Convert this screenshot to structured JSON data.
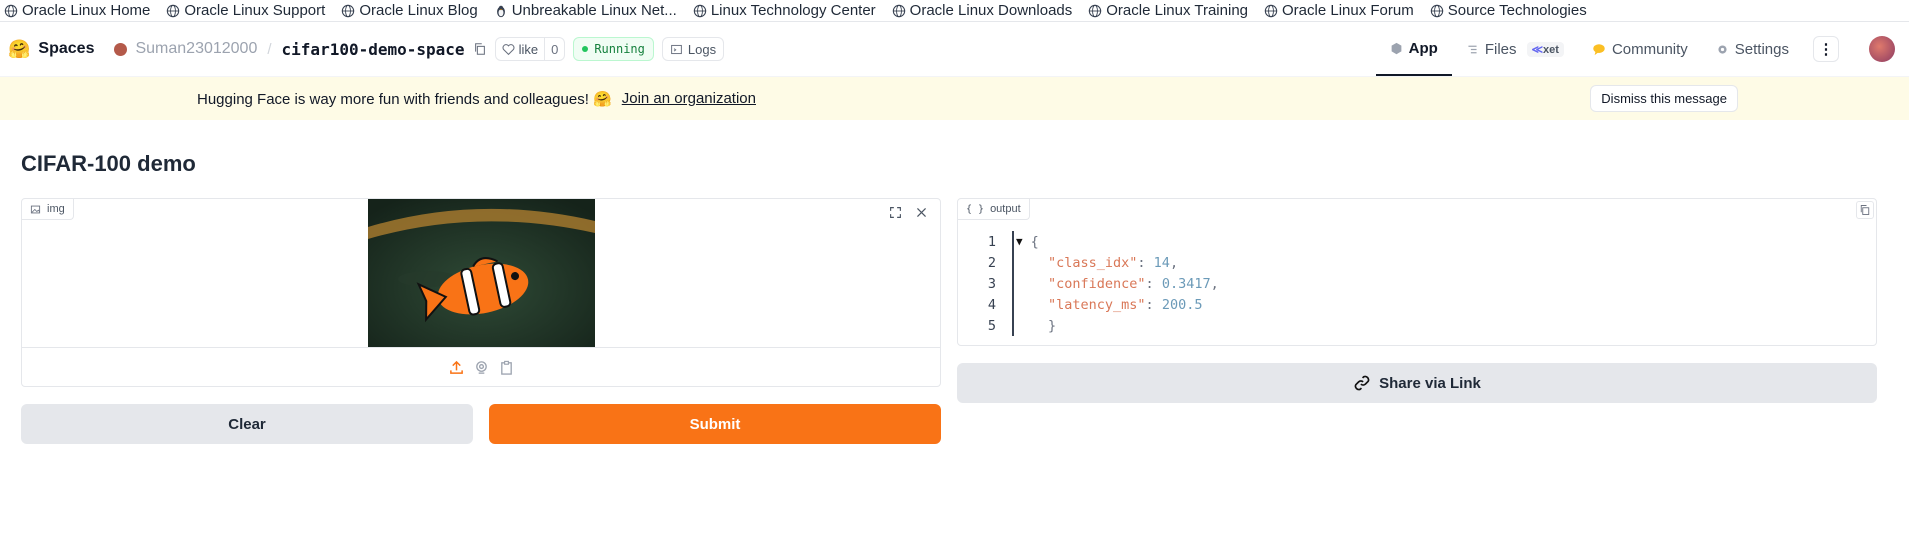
{
  "bookmarks": [
    {
      "label": "Oracle Linux Home",
      "icon": "globe-icon"
    },
    {
      "label": "Oracle Linux Support",
      "icon": "globe-icon"
    },
    {
      "label": "Oracle Linux Blog",
      "icon": "globe-icon"
    },
    {
      "label": "Unbreakable Linux Net...",
      "icon": "penguin-icon"
    },
    {
      "label": "Linux Technology Center",
      "icon": "globe-icon"
    },
    {
      "label": "Oracle Linux Downloads",
      "icon": "globe-icon"
    },
    {
      "label": "Oracle Linux Training",
      "icon": "globe-icon"
    },
    {
      "label": "Oracle Linux Forum",
      "icon": "globe-icon"
    },
    {
      "label": "Source Technologies",
      "icon": "globe-icon"
    }
  ],
  "header": {
    "spaces_label": "Spaces",
    "user": "Suman23012000",
    "repo": "cifar100-demo-space",
    "like_label": "like",
    "like_count": "0",
    "status": "Running",
    "logs_label": "Logs",
    "tabs": [
      {
        "label": "App"
      },
      {
        "label": "Files"
      },
      {
        "label": "Community"
      },
      {
        "label": "Settings"
      }
    ],
    "xet_label": "xet"
  },
  "banner": {
    "text": "Hugging Face is way more fun with friends and colleagues! 🤗",
    "link": "Join an organization",
    "dismiss": "Dismiss this message"
  },
  "app": {
    "title": "CIFAR-100 demo",
    "input_label": "img",
    "output_label": "output",
    "clear_label": "Clear",
    "submit_label": "Submit",
    "share_label": "Share via Link",
    "code_lines": [
      {
        "n": "1",
        "text": "{"
      },
      {
        "n": "2",
        "key": "\"class_idx\"",
        "val": "14"
      },
      {
        "n": "3",
        "key": "\"confidence\"",
        "val": "0.3417"
      },
      {
        "n": "4",
        "key": "\"latency_ms\"",
        "val": "200.5"
      },
      {
        "n": "5",
        "text": "}"
      }
    ]
  },
  "colors": {
    "accent": "#f97316",
    "banner": "#fefbe6",
    "running": "#15803d"
  }
}
